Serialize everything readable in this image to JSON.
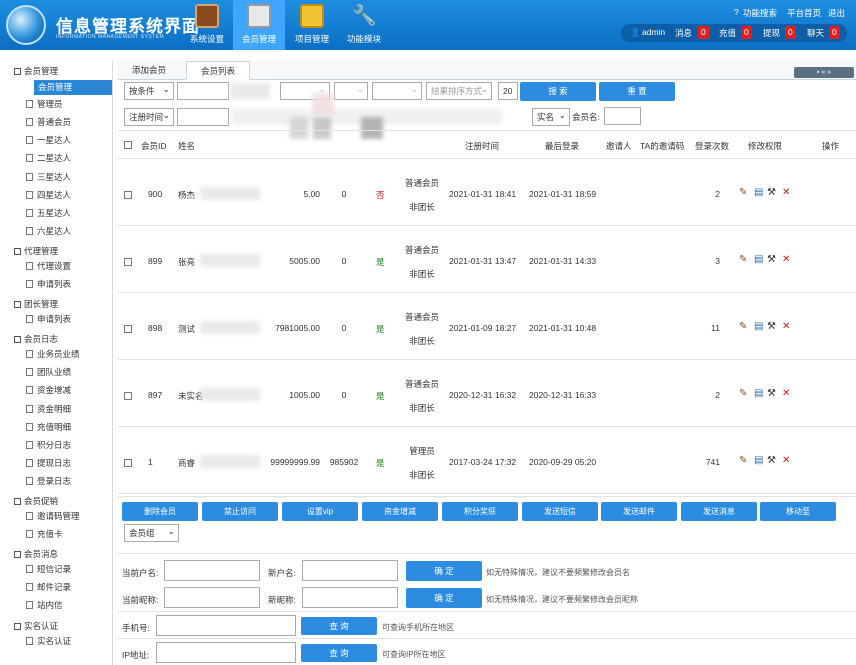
{
  "header": {
    "title": "信息管理系统界面",
    "subtitle": "INFORMATION MANAGEMENT SYSTEM",
    "nav": [
      {
        "label": "系统设置",
        "icon": "book-icon"
      },
      {
        "label": "会员管理",
        "icon": "printer-icon"
      },
      {
        "label": "项目管理",
        "icon": "folder-icon"
      },
      {
        "label": "功能模块",
        "icon": "tools-icon"
      }
    ],
    "links": [
      "功能搜索",
      "平台首页",
      "退出"
    ],
    "user": "admin",
    "counters": [
      {
        "label": "消息",
        "value": "0"
      },
      {
        "label": "充值",
        "value": "0"
      },
      {
        "label": "提现",
        "value": "0"
      },
      {
        "label": "聊天",
        "value": "0"
      }
    ]
  },
  "sidebar": {
    "groups": [
      {
        "label": "会员管理",
        "items": [
          "会员管理",
          "管理员",
          "普通会员",
          "一星达人",
          "二星达人",
          "三星达人",
          "四星达人",
          "五星达人",
          "六星达人"
        ]
      },
      {
        "label": "代理管理",
        "items": [
          "代理设置",
          "申请列表"
        ]
      },
      {
        "label": "团长管理",
        "items": [
          "申请列表"
        ]
      },
      {
        "label": "会员日志",
        "items": [
          "业务员业绩",
          "团队业绩",
          "资金增减",
          "资金明细",
          "充值明细",
          "积分日志",
          "提现日志",
          "登录日志"
        ]
      },
      {
        "label": "会员促销",
        "items": [
          "邀请码管理",
          "充值卡"
        ]
      },
      {
        "label": "会员消息",
        "items": [
          "短信记录",
          "邮件记录",
          "站内信"
        ]
      },
      {
        "label": "实名认证",
        "items": [
          "实名认证"
        ]
      }
    ]
  },
  "tabs": [
    "添加会员",
    "会员列表"
  ],
  "pager": "▪ « »",
  "filters": {
    "cond": "按条件",
    "ph1": "",
    "ph2": "",
    "ph3": "",
    "ph4": "",
    "ph5": "",
    "orderby": "结果排序方式",
    "pagesize": "20",
    "search": "搜 索",
    "reset": "重 置",
    "timefield": "注册时间",
    "realname": "实名",
    "member_label": "会员名:"
  },
  "table": {
    "headers": [
      "会员ID",
      "姓名",
      "",
      "",
      "",
      "",
      "",
      "注册时间",
      "最后登录",
      "邀请人",
      "TA的邀请码",
      "登录次数",
      "修改权限",
      "操作"
    ],
    "rows": [
      {
        "id": "900",
        "name": "杨杰",
        "bal": "5.00",
        "pts": "0",
        "st": "否",
        "role": "普通会员",
        "sub": "非团长",
        "reg": "2021-01-31 18:41",
        "last": "2021-01-31 18:59",
        "cnt": "2"
      },
      {
        "id": "899",
        "name": "张亮",
        "bal": "5005.00",
        "pts": "0",
        "st": "是",
        "role": "普通会员",
        "sub": "非团长",
        "reg": "2021-01-31 13:47",
        "last": "2021-01-31 14:33",
        "cnt": "3"
      },
      {
        "id": "898",
        "name": "测试",
        "bal": "7981005.00",
        "pts": "0",
        "st": "是",
        "role": "普通会员",
        "sub": "非团长",
        "reg": "2021-01-09 18:27",
        "last": "2021-01-31 10:48",
        "cnt": "11"
      },
      {
        "id": "897",
        "name": "未实名",
        "bal": "1005.00",
        "pts": "0",
        "st": "是",
        "role": "普通会员",
        "sub": "非团长",
        "reg": "2020-12-31 16:32",
        "last": "2020-12-31 16:33",
        "cnt": "2"
      },
      {
        "id": "1",
        "name": "商睿",
        "bal": "99999999.99",
        "pts": "985902",
        "st": "是",
        "role": "管理员",
        "sub": "非团长",
        "reg": "2017-03-24 17:32",
        "last": "2020-09-29 05:20",
        "cnt": "741"
      }
    ]
  },
  "bulk": [
    "删除会员",
    "禁止访问",
    "设置vip",
    "资金增减",
    "积分奖惩",
    "发送短信",
    "发送邮件",
    "发送消息",
    "移动至"
  ],
  "group_select": "会员组",
  "forms": {
    "old_name": "当前户名:",
    "new_name": "新户名:",
    "ok1": "确 定",
    "hint1": "如无特殊情况，建议不要频繁修改会员名",
    "old_nick": "当前昵称:",
    "new_nick": "新昵称:",
    "ok2": "确 定",
    "hint2": "如无特殊情况，建议不要频繁修改会员昵称",
    "phone": "手机号:",
    "q1": "查 询",
    "hint3": "可查询手机所在地区",
    "ip": "IP地址:",
    "q2": "查 询",
    "hint4": "可查询IP所在地区"
  },
  "colors": {
    "accent": "#2b8ce0",
    "header": "#1481d8",
    "danger": "#e02020",
    "yes": "#1a8a1a",
    "no": "#cc2222"
  }
}
